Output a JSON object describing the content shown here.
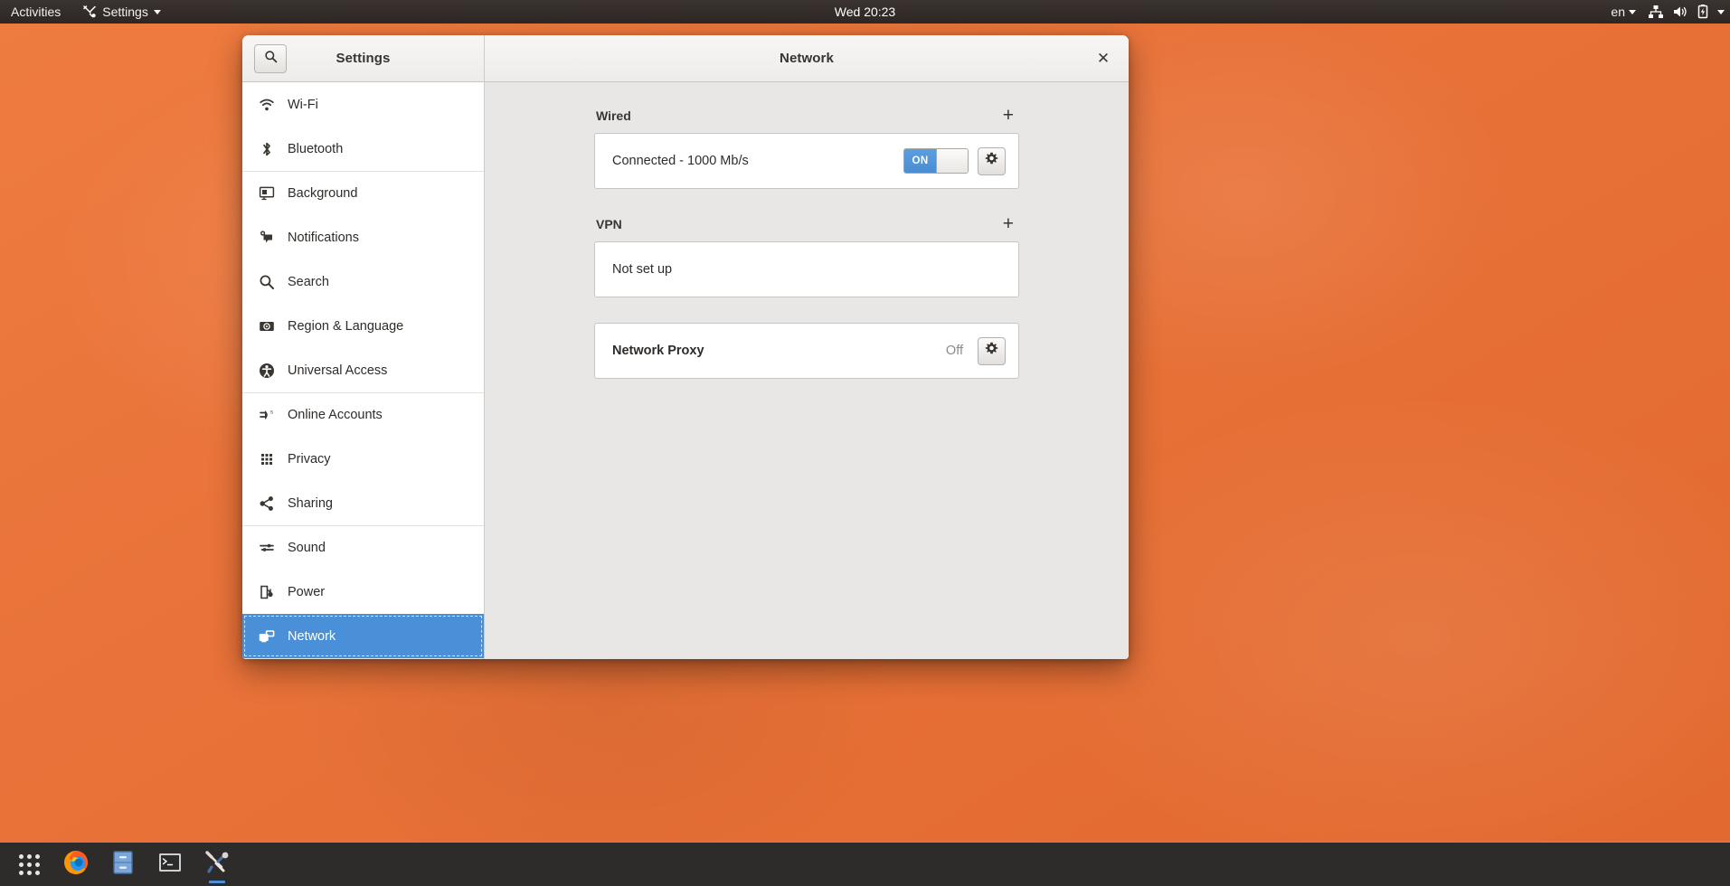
{
  "topbar": {
    "activities_label": "Activities",
    "app_menu_label": "Settings",
    "app_menu_icon": "tools-icon",
    "clock": "Wed 20:23",
    "keyboard_layout": "en",
    "status_icons": [
      "network-wired-icon",
      "volume-icon",
      "battery-icon",
      "chevron-down-icon"
    ]
  },
  "window": {
    "sidebar_header_title": "Settings",
    "search_icon": "search-icon",
    "content_header_title": "Network",
    "close_icon": "close-icon"
  },
  "sidebar": {
    "items": [
      {
        "label": "Wi-Fi",
        "icon": "wifi-icon",
        "separator_above": false,
        "selected": false
      },
      {
        "label": "Bluetooth",
        "icon": "bluetooth-icon",
        "separator_above": false,
        "selected": false
      },
      {
        "label": "Background",
        "icon": "background-icon",
        "separator_above": true,
        "selected": false
      },
      {
        "label": "Notifications",
        "icon": "notifications-icon",
        "separator_above": false,
        "selected": false
      },
      {
        "label": "Search",
        "icon": "search-icon",
        "separator_above": false,
        "selected": false
      },
      {
        "label": "Region & Language",
        "icon": "region-language-icon",
        "separator_above": false,
        "selected": false
      },
      {
        "label": "Universal Access",
        "icon": "universal-access-icon",
        "separator_above": false,
        "selected": false
      },
      {
        "label": "Online Accounts",
        "icon": "online-accounts-icon",
        "separator_above": true,
        "selected": false
      },
      {
        "label": "Privacy",
        "icon": "privacy-icon",
        "separator_above": false,
        "selected": false
      },
      {
        "label": "Sharing",
        "icon": "sharing-icon",
        "separator_above": false,
        "selected": false
      },
      {
        "label": "Sound",
        "icon": "sound-icon",
        "separator_above": true,
        "selected": false
      },
      {
        "label": "Power",
        "icon": "power-icon",
        "separator_above": false,
        "selected": false
      },
      {
        "label": "Network",
        "icon": "network-icon",
        "separator_above": false,
        "selected": true
      }
    ]
  },
  "network_panel": {
    "wired": {
      "section_title": "Wired",
      "add_label": "+",
      "status": "Connected - 1000 Mb/s",
      "toggle_state": "ON",
      "settings_icon": "gear-icon"
    },
    "vpn": {
      "section_title": "VPN",
      "add_label": "+",
      "status": "Not set up"
    },
    "proxy": {
      "label": "Network Proxy",
      "value": "Off",
      "settings_icon": "gear-icon"
    }
  },
  "dock": {
    "items": [
      {
        "name": "show-applications",
        "icon": "grid-icon",
        "active": false
      },
      {
        "name": "firefox",
        "icon": "firefox-icon",
        "active": false
      },
      {
        "name": "file-manager",
        "icon": "files-icon",
        "active": false
      },
      {
        "name": "terminal",
        "icon": "terminal-icon",
        "active": false
      },
      {
        "name": "settings",
        "icon": "tools-icon",
        "active": true
      }
    ]
  },
  "colors": {
    "accent": "#4a90d9",
    "desktop": "#e8703a",
    "topbar": "#2d2724",
    "window_bg": "#e9e7e5"
  }
}
